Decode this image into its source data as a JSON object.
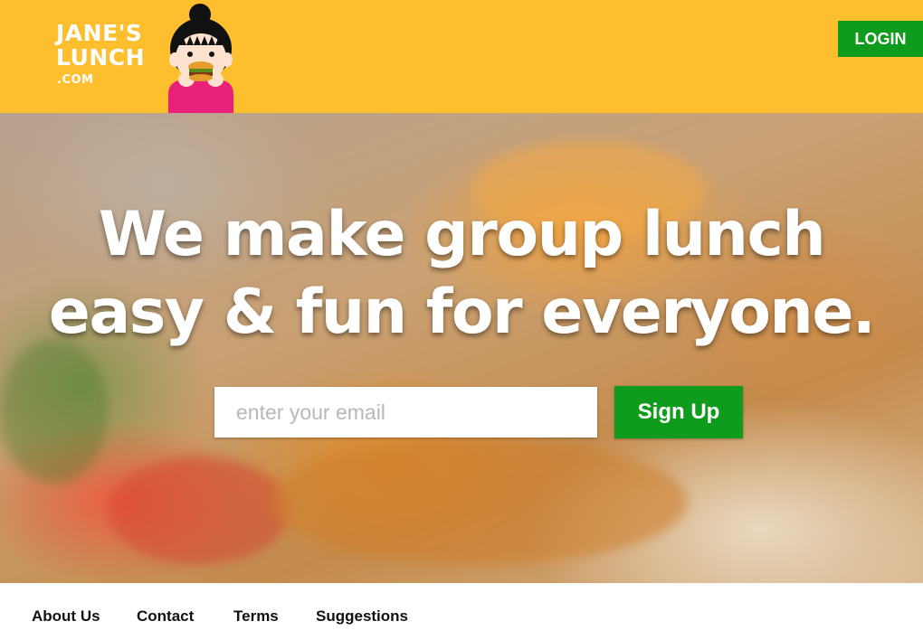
{
  "header": {
    "logo": {
      "line1": "JANE'S",
      "line2": "LUNCH",
      "line3": ".COM"
    },
    "login_label": "LOGIN"
  },
  "hero": {
    "headline_line1": "We make group lunch",
    "headline_line2": "easy & fun for everyone.",
    "email_placeholder": "enter your email",
    "email_value": "",
    "signup_label": "Sign Up"
  },
  "footer": {
    "links": [
      {
        "label": "About Us"
      },
      {
        "label": "Contact"
      },
      {
        "label": "Terms"
      },
      {
        "label": "Suggestions"
      }
    ]
  },
  "colors": {
    "header_bg": "#fdbf2d",
    "button_green": "#0f9b1c",
    "text_white": "#ffffff"
  },
  "icons": {
    "mascot": "girl-eating-burger-icon"
  }
}
